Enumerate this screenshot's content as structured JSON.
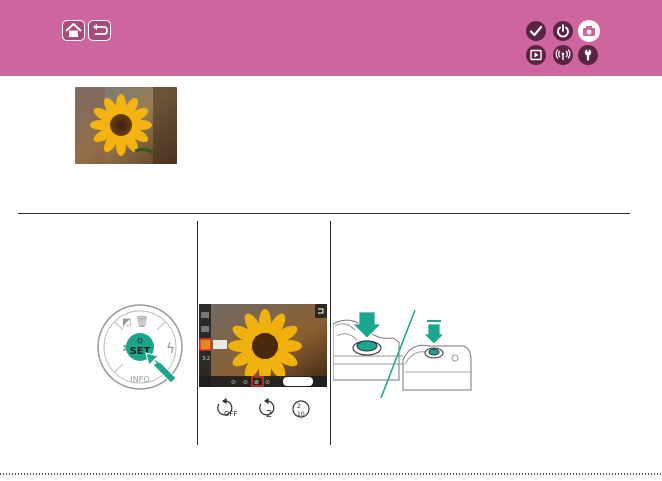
{
  "header": {
    "background_color": "#cf659e",
    "nav_buttons": [
      {
        "name": "home",
        "icon": "home-icon"
      },
      {
        "name": "back",
        "icon": "back-arrow-icon"
      }
    ],
    "category_buttons": [
      {
        "name": "basic",
        "icon": "check-icon"
      },
      {
        "name": "power",
        "icon": "power-icon"
      },
      {
        "name": "shooting",
        "icon": "camera-icon",
        "active": true
      },
      {
        "name": "playback",
        "icon": "play-icon"
      },
      {
        "name": "wireless",
        "icon": "wireless-icon"
      },
      {
        "name": "setup",
        "icon": "wrench-icon"
      }
    ]
  },
  "illustrations": {
    "sample_photo": "sunflower-photo",
    "control_dial": {
      "center_label": "SET",
      "bottom_label": "INFO",
      "icons": [
        "exposure-comp-icon",
        "trash-icon",
        "flash-icon",
        "ae-lock-icon",
        "q-icon"
      ]
    },
    "screen": {
      "highlight_color": "#e0302c"
    },
    "self_timer_modes": [
      "self-timer-off-icon",
      "self-timer-2s-icon",
      "self-timer-custom-icon"
    ],
    "cameras": {
      "accent_color": "#1aa58c"
    }
  }
}
